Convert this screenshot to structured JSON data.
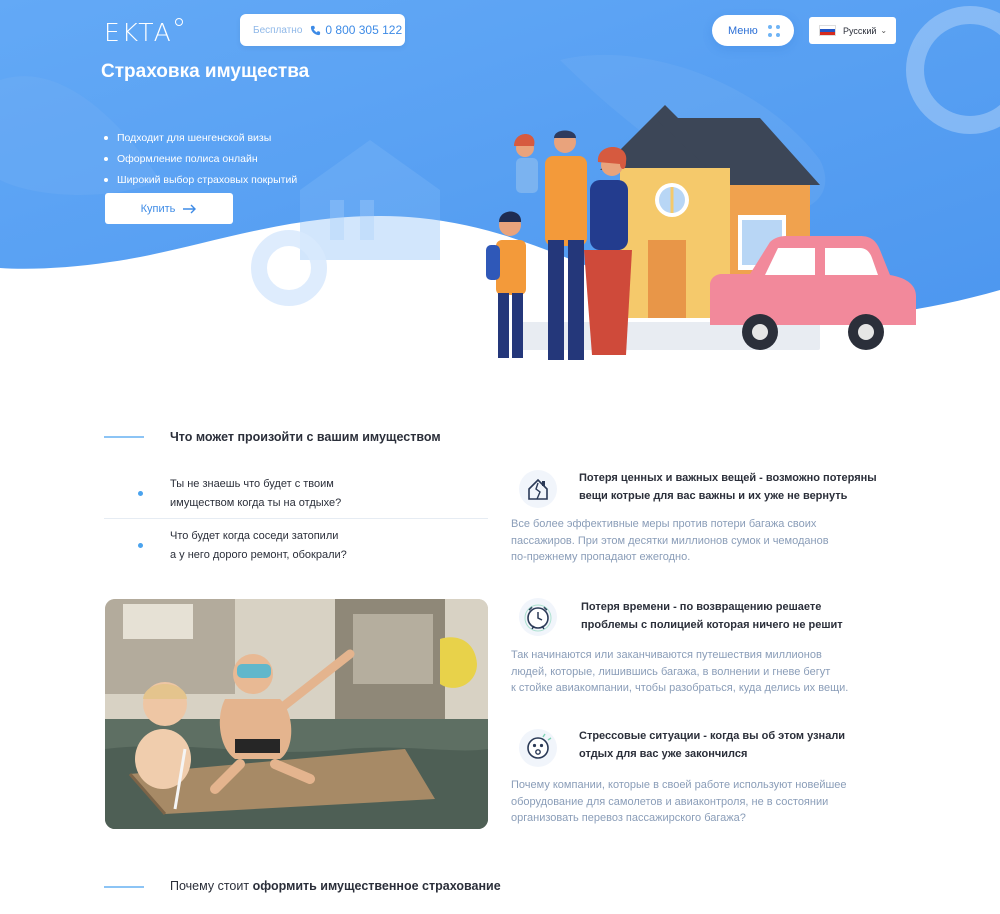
{
  "header": {
    "logo_text": "EKTA",
    "phone_free": "Бесплатно",
    "phone_number": "0 800 305 122",
    "menu_label": "Меню",
    "language": "Русский"
  },
  "hero": {
    "title": "Страховка имущества",
    "features": [
      "Подходит для шенгенской визы",
      "Оформление полиса онлайн",
      "Широкий выбор страховых покрытий"
    ],
    "buy_label": "Купить"
  },
  "section1": {
    "title": "Что может произойти с вашим имуществом",
    "questions": [
      {
        "line1": "Ты не знаешь что будет с твоим",
        "line2": "имуществом когда ты на отдыхе?"
      },
      {
        "line1": "Что будет когда соседи затопили",
        "line2": "а у него дорого ремонт, обокрали?"
      }
    ],
    "risks": [
      {
        "icon": "broken-house-icon",
        "title_line1": "Потеря ценных и важных вещей - возможно потеряны",
        "title_line2": "вещи котрые для вас важны и их уже не вернуть",
        "desc_line1": "Все более эффективные меры против потери багажа своих",
        "desc_line2": "пассажиров. При этом десятки миллионов сумок и чемоданов",
        "desc_line3": "по-прежнему пропадают ежегодно."
      },
      {
        "icon": "alarm-clock-icon",
        "title_line1": "Потеря времени - по возвращению решаете",
        "title_line2": "проблемы с полицией которая ничего не решит",
        "desc_line1": "Так начинаются или заканчиваются путешествия миллионов",
        "desc_line2": "людей, которые, лишившись багажа, в волнении и гневе бегут",
        "desc_line3": "к стойке авиакомпании, чтобы разобраться, куда делись их вещи."
      },
      {
        "icon": "stressed-face-icon",
        "title_line1": "Стрессовые ситуации - когда вы об этом узнали",
        "title_line2": "отдых для вас уже закончился",
        "desc_line1": "Почему компании, которые в своей работе используют новейшее",
        "desc_line2": "оборудование для самолетов и авиаконтроля, не в состоянии",
        "desc_line3": "организовать перевоз пассажирского багажа?"
      }
    ]
  },
  "section2": {
    "title_prefix": "Почему стоит ",
    "title_bold": "оформить имущественное страхование"
  },
  "colors": {
    "hero_blue": "#5ea7f5",
    "accent": "#3e8be6",
    "muted_text": "#8a9db8"
  }
}
